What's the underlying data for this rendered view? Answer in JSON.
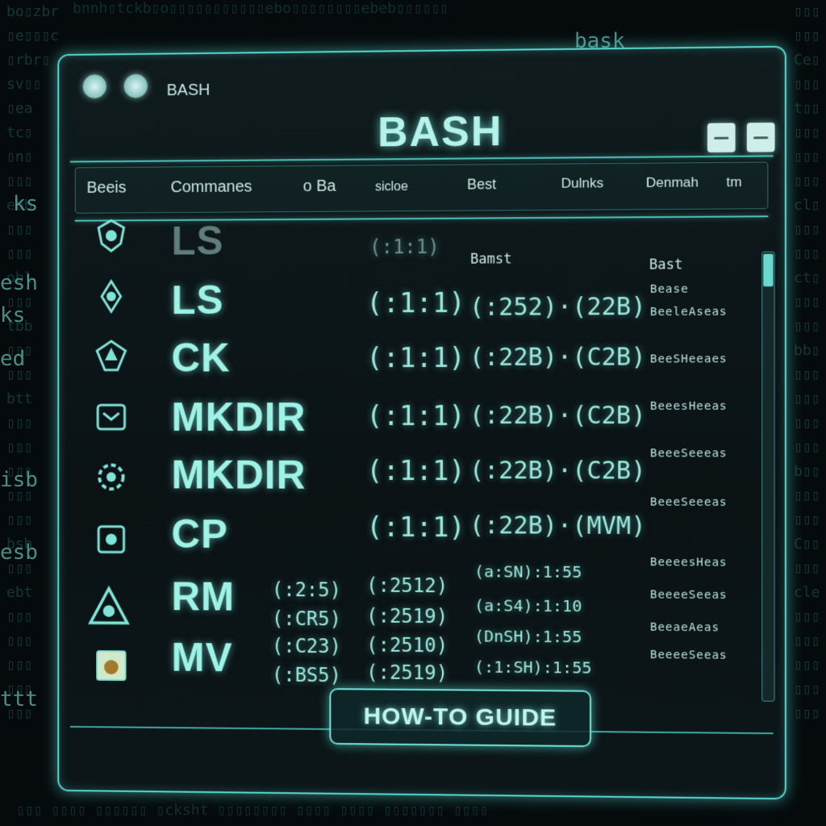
{
  "background": {
    "words": [
      "bask",
      "ks",
      "esh",
      "ks",
      "ed",
      "isb",
      "esb",
      "ttt"
    ]
  },
  "window": {
    "label": "BASH",
    "title": "BASH"
  },
  "header_bar": {
    "left": "Beeis",
    "commands": "Commanes",
    "mid": "o Ba",
    "guide": "sicloe",
    "right1": "Best",
    "right2": "Dulnks",
    "right3": "Denmah",
    "right4": "tm"
  },
  "columns": {
    "best": "Bamst",
    "desc": "Bast"
  },
  "rows": [
    {
      "cmd": "LS",
      "v1": "(:1:1)",
      "v2": "",
      "dim": true,
      "desc": "Bease"
    },
    {
      "cmd": "LS",
      "v1": "(:1:1)",
      "v2": "(:252)·(22B)",
      "desc": "BeeleAseas"
    },
    {
      "cmd": "CK",
      "v1": "(:1:1)",
      "v2": "(:22B)·(C2B)",
      "desc": "BeeSHeeaes"
    },
    {
      "cmd": "MKDIR",
      "v1": "(:1:1)",
      "v2": "(:22B)·(C2B)",
      "desc": "BeeesHeeas"
    },
    {
      "cmd": "MKDIR",
      "v1": "(:1:1)",
      "v2": "(:22B)·(C2B)",
      "desc": "BeeeSeeeas"
    },
    {
      "cmd": "CP",
      "v1": "(:1:1)",
      "v2": "(:22B)·(MVM)",
      "desc": "BeeeSeeeas"
    },
    {
      "cmd": "RM",
      "v1": "(:2:5)",
      "v2": "(:2512)",
      "v3": "(a:SN):1:55",
      "desc": "BeeeesHeas"
    },
    {
      "cmd": "",
      "v1": "(:CR5)",
      "v2": "(:2519)",
      "v3": "(a:S4):1:10",
      "desc": "BeeeeSeeas"
    },
    {
      "cmd": "MV",
      "v1": "(:C23)",
      "v2": "(:2510)",
      "v3": "(DnSH):1:55",
      "desc": "BeeaeAeas"
    },
    {
      "cmd": "",
      "v1": "(:BS5)",
      "v2": "(:2519)",
      "v3": "(:1:SH):1:55",
      "desc": "BeeeeSeeas"
    }
  ],
  "guide_button": "HOW-TO GUIDE",
  "colors": {
    "accent": "#58d6cf",
    "text": "#9ff2e6",
    "background": "#050b0c"
  }
}
